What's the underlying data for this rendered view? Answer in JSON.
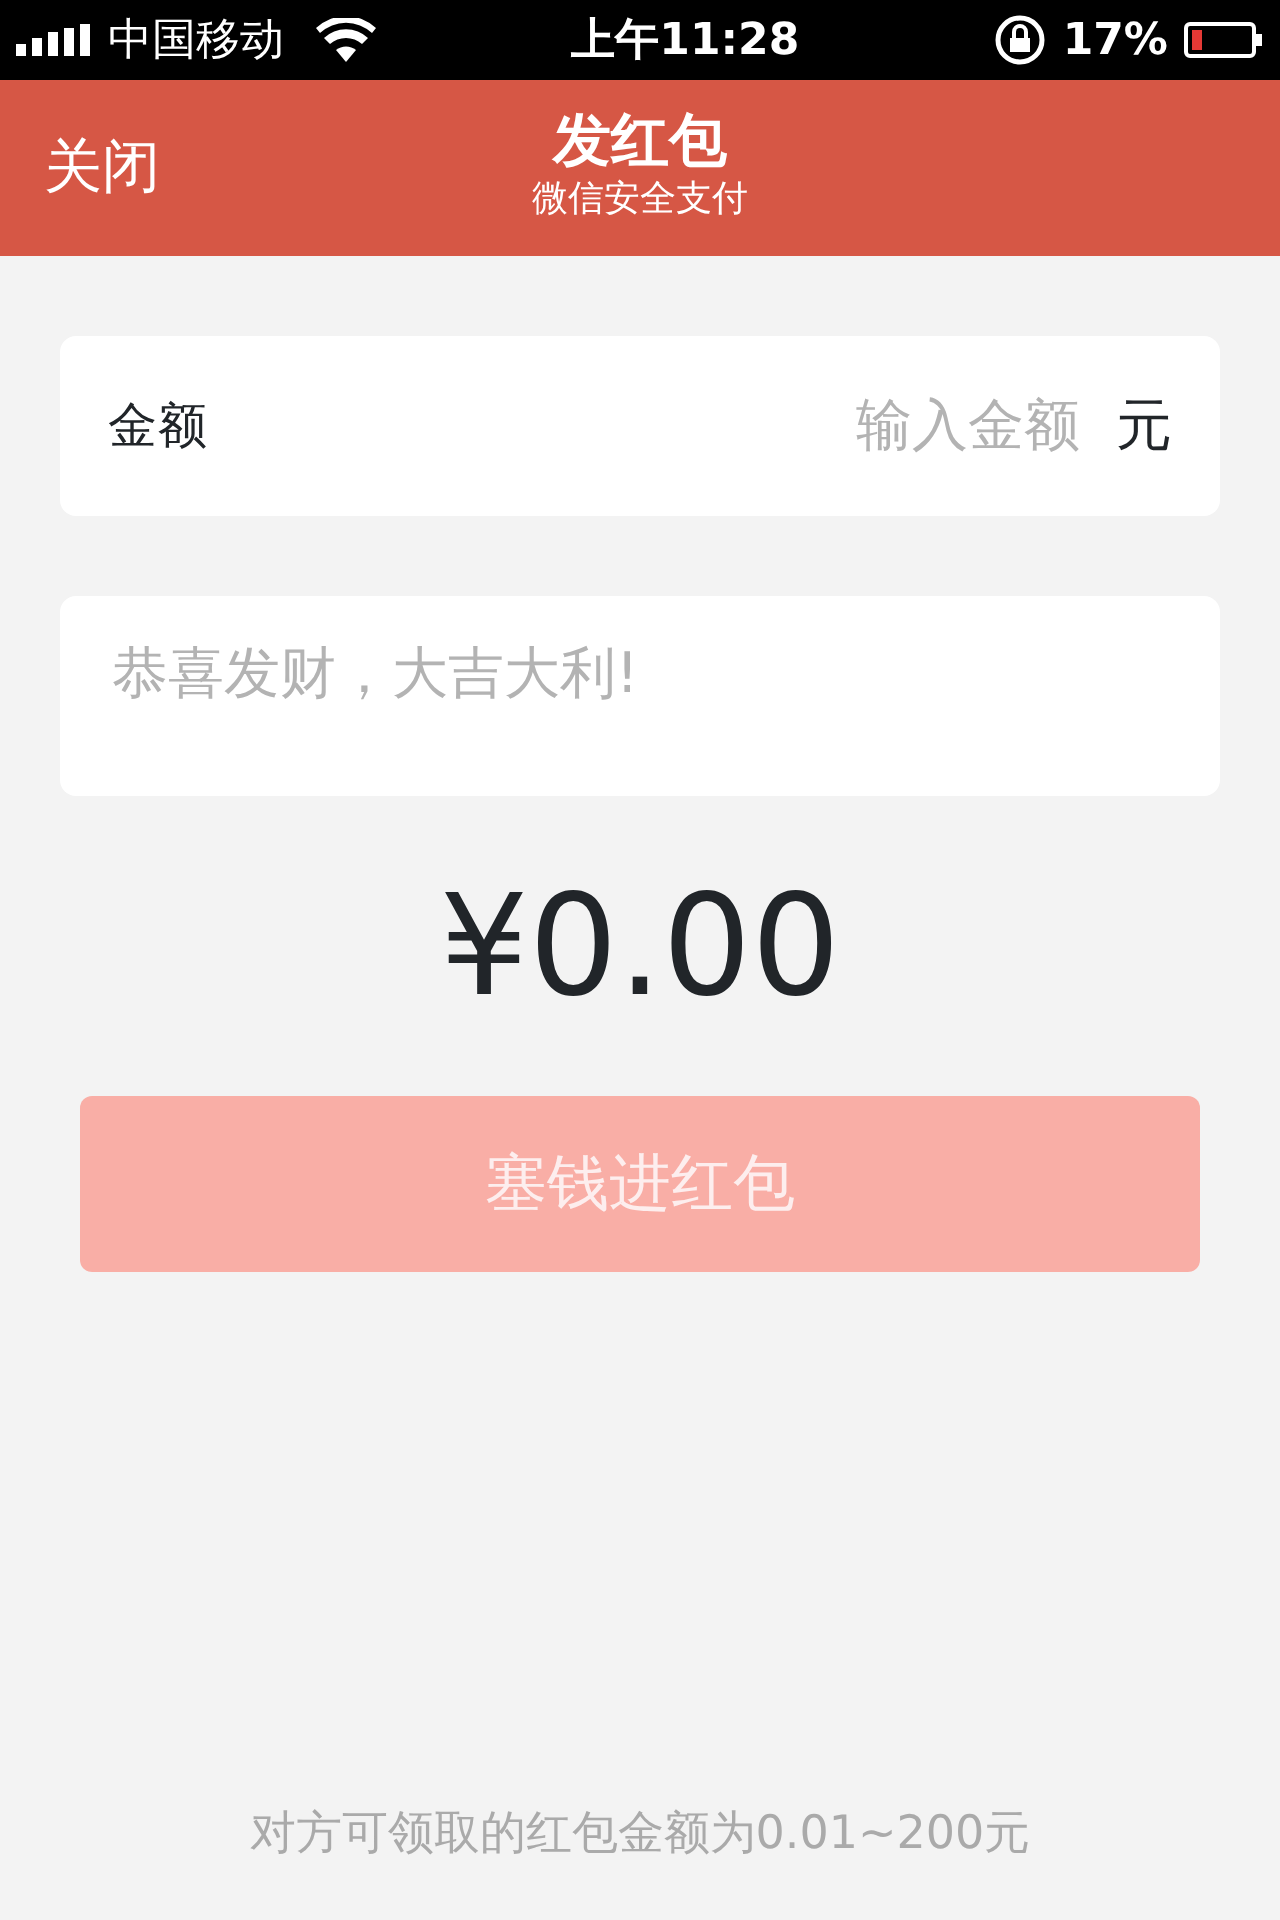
{
  "status_bar": {
    "carrier": "中国移动",
    "time": "上午11:28",
    "battery": "17%"
  },
  "nav_bar": {
    "close": "关闭",
    "title": "发红包",
    "subtitle": "微信安全支付"
  },
  "amount_field": {
    "label": "金额",
    "placeholder": "输入金额",
    "unit": "元"
  },
  "message_field": {
    "placeholder": "恭喜发财，大吉大利!"
  },
  "total": "¥0.00",
  "submit_button": {
    "label": "塞钱进红包",
    "disabled": true
  },
  "footer_note": "对方可领取的红包金额为0.01~200元"
}
